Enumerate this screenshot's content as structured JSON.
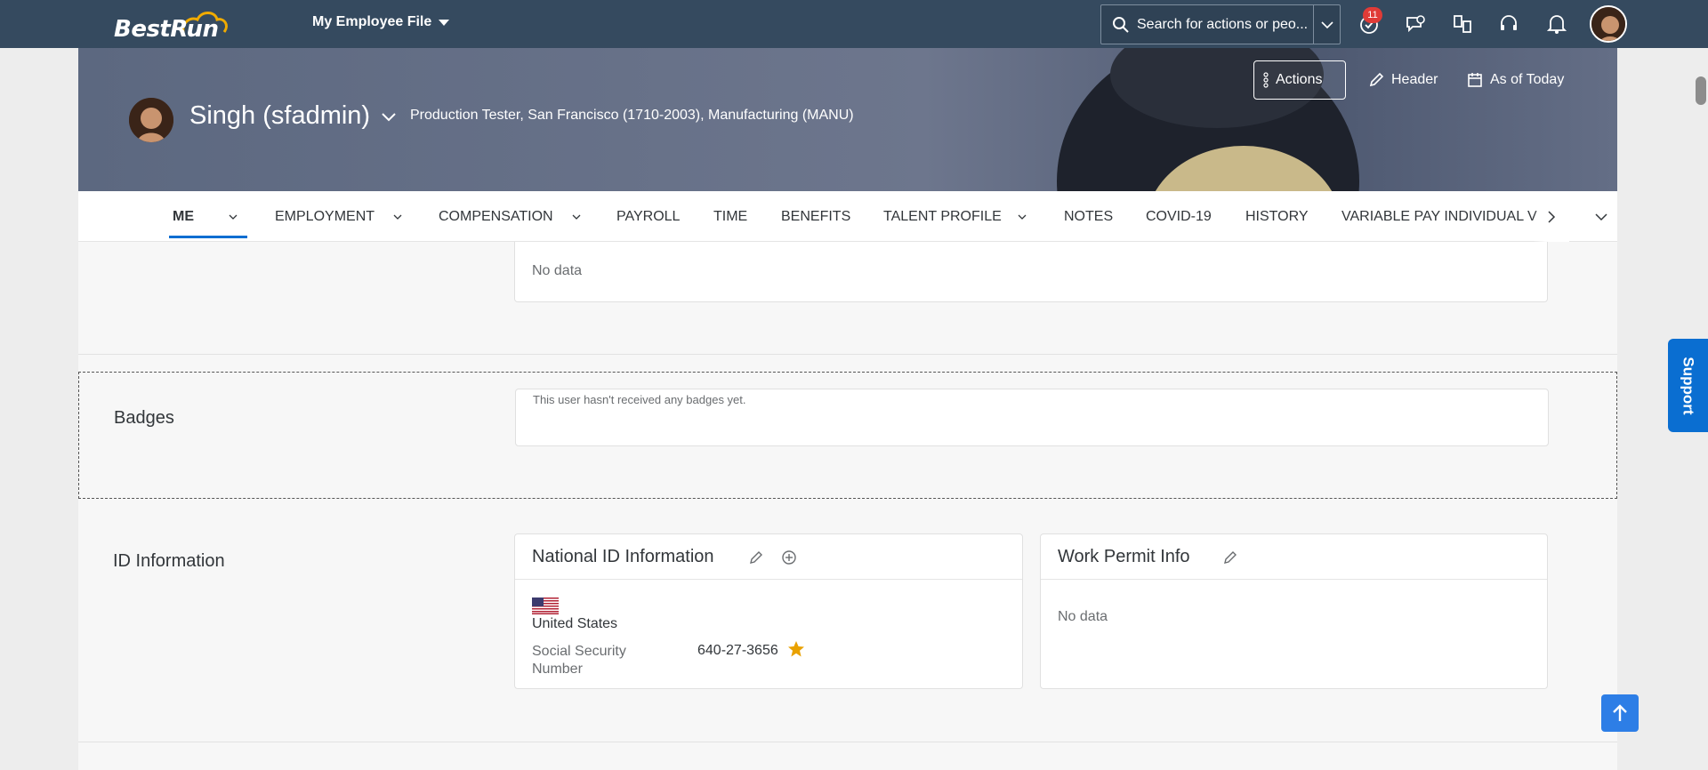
{
  "shell": {
    "logo_text": "BestRun",
    "title": "My Employee File",
    "search_placeholder": "Search for actions or peo...",
    "notification_count": "11"
  },
  "header": {
    "name": "Singh (sfadmin)",
    "subtitle": "Production Tester, San Francisco (1710-2003), Manufacturing (MANU)",
    "actions_label": "Actions",
    "header_label": "Header",
    "as_of_label": "As of Today"
  },
  "tabs": [
    {
      "label": "ME"
    },
    {
      "label": "EMPLOYMENT"
    },
    {
      "label": "COMPENSATION"
    },
    {
      "label": "PAYROLL"
    },
    {
      "label": "TIME"
    },
    {
      "label": "BENEFITS"
    },
    {
      "label": "TALENT PROFILE"
    },
    {
      "label": "NOTES"
    },
    {
      "label": "COVID-19"
    },
    {
      "label": "HISTORY"
    },
    {
      "label": "VARIABLE PAY INDIVIDUAL V"
    }
  ],
  "sections": {
    "top_card_text": "No data",
    "badges": {
      "label": "Badges",
      "message": "This user hasn't received any badges yet."
    },
    "id_info": {
      "label": "ID Information",
      "national": {
        "title": "National ID Information",
        "country": "United States",
        "field_label": "Social Security Number",
        "field_value": "640-27-3656"
      },
      "work_permit": {
        "title": "Work Permit Info",
        "text": "No data"
      }
    }
  },
  "support_label": "Support",
  "colors": {
    "shell_bg": "#354a5f",
    "accent": "#0a6ed1",
    "star": "#e9a100"
  }
}
